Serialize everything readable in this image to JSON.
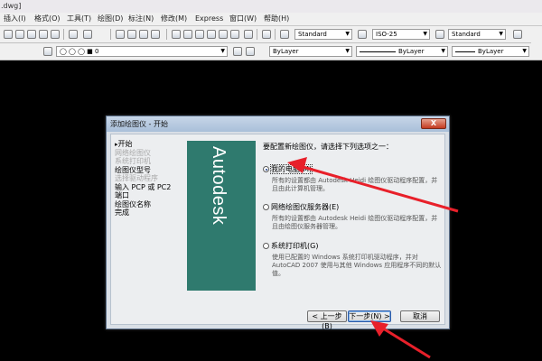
{
  "window": {
    "file_title": ".dwg]"
  },
  "menubar": {
    "items": [
      "插入(I)",
      "格式(O)",
      "工具(T)",
      "绘图(D)",
      "标注(N)",
      "修改(M)",
      "Express",
      "窗口(W)",
      "帮助(H)"
    ]
  },
  "toolbar": {
    "text_style": "Standard",
    "dim_style": "ISO-25",
    "table_style": "Standard",
    "layer": "0",
    "color": "ByLayer",
    "linetype": "ByLayer",
    "lineweight": "ByLayer"
  },
  "dialog": {
    "title": "添加绘图仪 - 开始",
    "close_label": "X",
    "banner_text": "Autodesk",
    "steps": [
      {
        "label": "开始",
        "state": "current"
      },
      {
        "label": "网络绘图仪",
        "state": "disabled"
      },
      {
        "label": "系统打印机",
        "state": "disabled"
      },
      {
        "label": "绘图仪型号",
        "state": "enabled"
      },
      {
        "label": "选择驱动程序",
        "state": "disabled"
      },
      {
        "label": "输入 PCP 或 PC2",
        "state": "enabled"
      },
      {
        "label": "端口",
        "state": "enabled"
      },
      {
        "label": "绘图仪名称",
        "state": "enabled"
      },
      {
        "label": "完成",
        "state": "enabled"
      }
    ],
    "prompt": "要配置新绘图仪，请选择下列选项之一：",
    "options": [
      {
        "label": "我的电脑(M)",
        "selected": true,
        "description": "所有的设置都由 Autodesk Heidi 绘图仪驱动程序配置，并且由此计算机管理。"
      },
      {
        "label": "网络绘图仪服务器(E)",
        "selected": false,
        "description": "所有的设置都由 Autodesk Heidi 绘图仪驱动程序配置，并且由绘图仪服务器管理。"
      },
      {
        "label": "系统打印机(G)",
        "selected": false,
        "description": "使用已配置的 Windows 系统打印机驱动程序，并对 AutoCAD 2007 使用与其他 Windows 应用程序不同的默认值。"
      }
    ],
    "buttons": {
      "back": "< 上一步(B)",
      "next": "下一步(N) >",
      "cancel": "取消"
    }
  },
  "colors": {
    "annotation_arrow": "#e8202a",
    "banner": "#2f7a6e",
    "background": "#000000"
  }
}
